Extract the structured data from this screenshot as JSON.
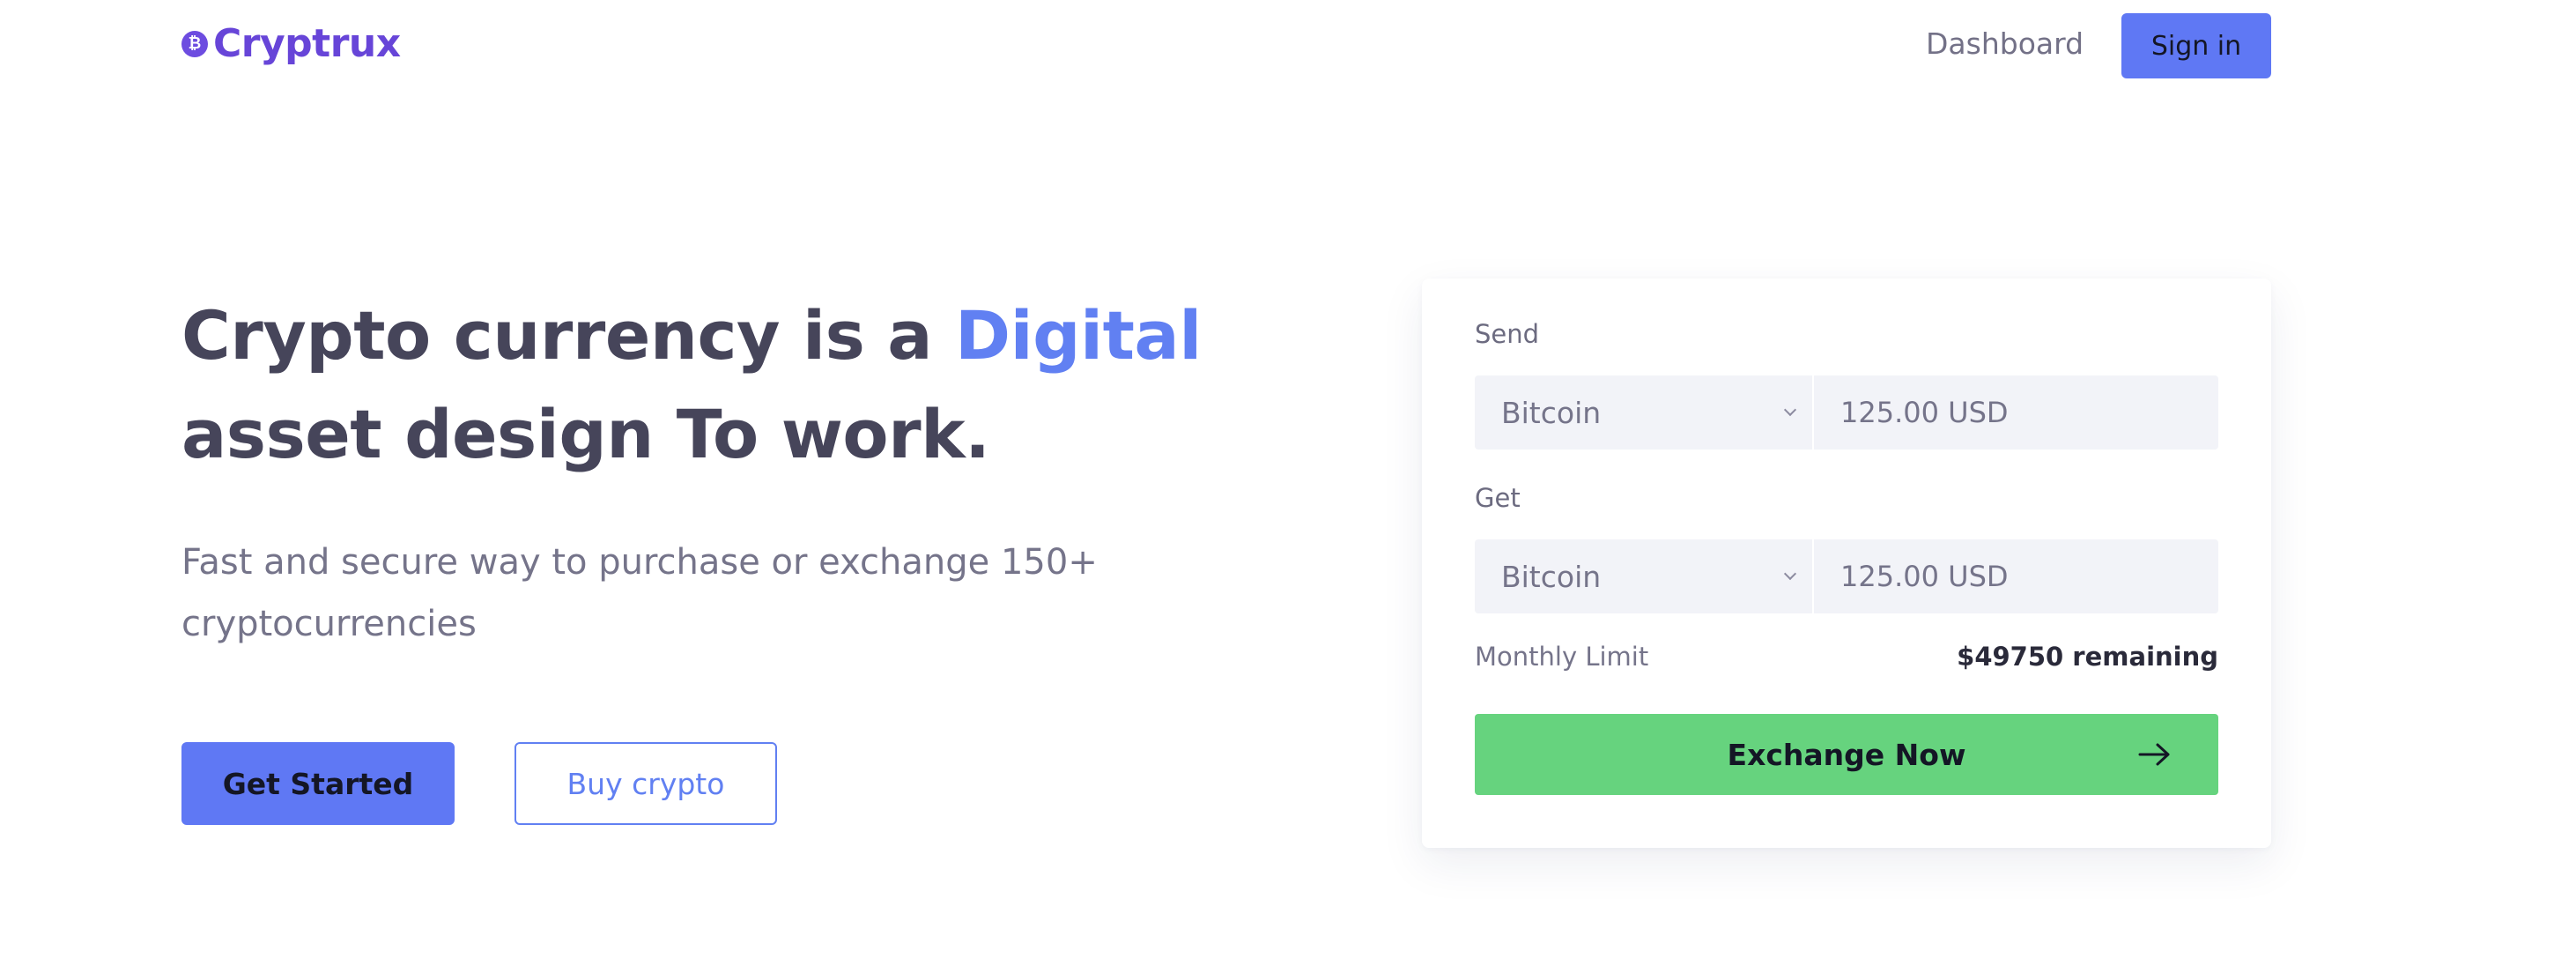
{
  "header": {
    "brand": "Cryptrux",
    "brand_icon": "bitcoin-coin-icon",
    "nav_dashboard": "Dashboard",
    "signin_label": "Sign in"
  },
  "hero": {
    "title_part1": "Crypto currency is a ",
    "title_accent": "Digital",
    "title_part2": "asset design To work.",
    "subtitle": "Fast and secure way to purchase or exchange 150+ cryptocurrencies",
    "primary_button": "Get Started",
    "secondary_button": "Buy crypto"
  },
  "exchange": {
    "send_label": "Send",
    "send_currency": "Bitcoin",
    "send_amount": "125.00 USD",
    "get_label": "Get",
    "get_currency": "Bitcoin",
    "get_amount": "125.00 USD",
    "limit_label": "Monthly Limit",
    "limit_value": "$49750 remaining",
    "button_label": "Exchange Now",
    "button_icon": "arrow-right-icon"
  },
  "colors": {
    "brand": "#6745d8",
    "accent": "#6180f2",
    "primary_button": "#5f78f4",
    "success_button": "#66d37e",
    "field_bg": "#f2f3f8"
  }
}
